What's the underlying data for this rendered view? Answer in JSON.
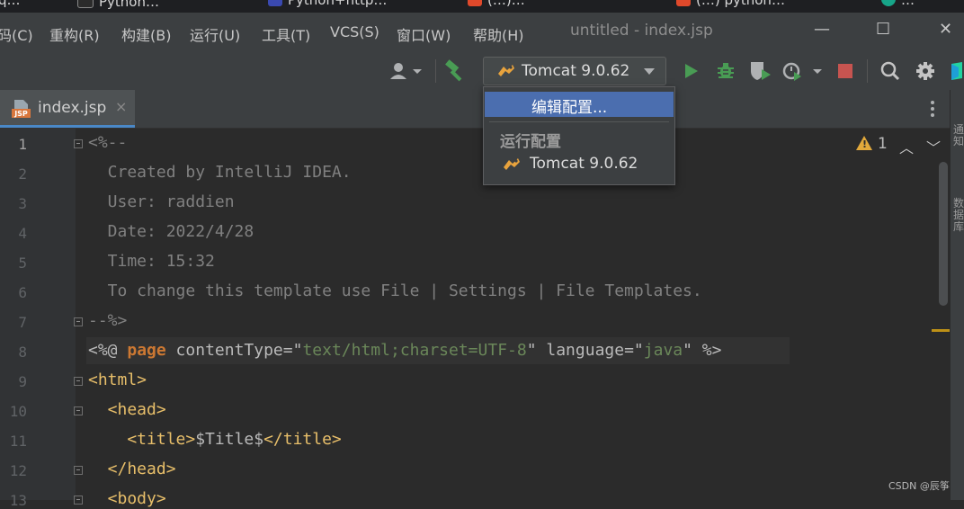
{
  "browser_tabs": [
    {
      "label": "q…",
      "icon_color": "#3a7bd5"
    },
    {
      "label": "Python…",
      "icon_color": "#2b2b2b"
    },
    {
      "label": "Python+http…",
      "icon_color": "#3a49b0"
    },
    {
      "label": "(…)…",
      "icon_color": "#e0492b"
    },
    {
      "label": "(…) python…",
      "icon_color": "#e0492b"
    },
    {
      "label": "…",
      "icon_color": "#17a589"
    }
  ],
  "menubar": {
    "items": [
      "码(C)",
      "重构(R)",
      "构建(B)",
      "运行(U)",
      "工具(T)",
      "VCS(S)",
      "窗口(W)",
      "帮助(H)"
    ],
    "window_title": "untitled - index.jsp",
    "minimize": "—",
    "maximize": "☐",
    "close": "✕"
  },
  "toolbar": {
    "run_config": "Tomcat 9.0.62",
    "icons": [
      "user-icon",
      "build-hammer-icon",
      "run-icon",
      "debug-icon",
      "coverage-icon",
      "profile-icon",
      "stop-icon",
      "search-icon",
      "settings-icon",
      "toolbox-icon"
    ],
    "colors": {
      "run": "#499c54",
      "debug": "#499c54",
      "stop": "#c75450",
      "hammer": "#499c54"
    }
  },
  "run_dropdown": {
    "selected_item": "编辑配置...",
    "section_header": "运行配置",
    "config_item": "Tomcat 9.0.62"
  },
  "editor_tab": {
    "icon_label": "JSP",
    "filename": "index.jsp",
    "close": "×"
  },
  "inspection": {
    "warning_count": "1",
    "warning_mark": "!",
    "up": "︿",
    "down": "﹀"
  },
  "right_strip": {
    "label1": "通知",
    "label2": "数据库"
  },
  "line_numbers": [
    "1",
    "2",
    "3",
    "4",
    "5",
    "6",
    "7",
    "8",
    "9",
    "10",
    "11",
    "12",
    "13"
  ],
  "code_lines": {
    "l1": "<%--",
    "l2": "  Created by IntelliJ IDEA.",
    "l3": "  User: raddien",
    "l4": "  Date: 2022/4/28",
    "l5": "  Time: 15:32",
    "l6": "  To change this template use File | Settings | File Templates.",
    "l7": "--%>",
    "l8": {
      "open": "<%@ ",
      "kw": "page",
      "a1": " contentType=",
      "q1": "\"",
      "v1": "text/html;charset=UTF-8",
      "q2": "\"",
      "a2": " language=",
      "q3": "\"",
      "v2": "java",
      "q4": "\"",
      "close": " %>"
    },
    "l9": "<html>",
    "l10": "  <head>",
    "l11": {
      "open": "    <title>",
      "text": "$Title$",
      "close": "</title>"
    },
    "l12": "  </head>",
    "l13": "  <body>"
  },
  "watermark": "CSDN @辰筝"
}
